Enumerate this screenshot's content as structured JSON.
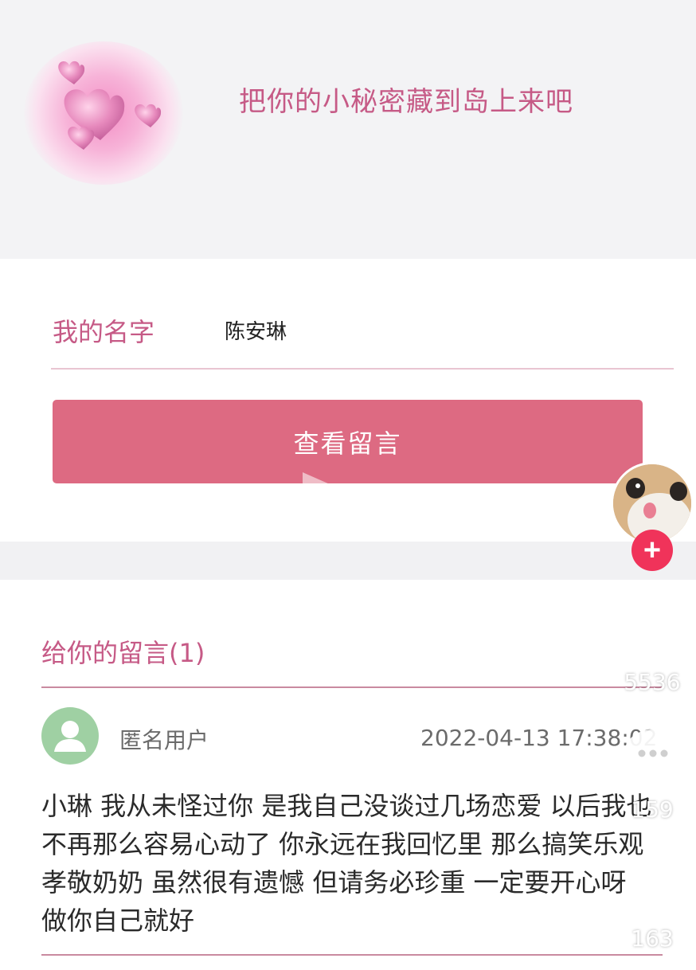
{
  "header": {
    "tagline": "把你的小秘密藏到岛上来吧"
  },
  "form": {
    "name_label": "我的名字",
    "name_value": "陈安琳",
    "view_button_label": "查看留言"
  },
  "messages": {
    "title": "给你的留言(1)",
    "items": [
      {
        "user": "匿名用户",
        "time": "2022-04-13 17:38:02",
        "body": "小琳 我从未怪过你 是我自己没谈过几场恋爱 以后我也不再那么容易心动了 你永远在我回忆里 那么搞笑乐观 孝敬奶奶 虽然很有遗憾 但请务必珍重 一定要开心呀 做你自己就好"
      }
    ]
  },
  "sidebar": {
    "follow_label": "+",
    "like_count": "5536",
    "comment_count": "159",
    "favorite_count": "163"
  },
  "colors": {
    "accent": "#c65a86",
    "button": "#dd6a82",
    "follow": "#f0335a",
    "user_avatar": "#9fd0a3"
  },
  "icons": [
    "hearts-logo-icon",
    "play-icon",
    "user-silhouette-icon",
    "heart-icon",
    "comment-icon",
    "star-icon"
  ]
}
